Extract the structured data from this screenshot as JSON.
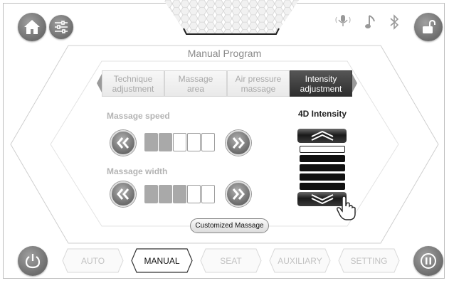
{
  "title": "Manual Program",
  "tabs": [
    {
      "label": "Technique\nadjustment",
      "active": false
    },
    {
      "label": "Massage\narea",
      "active": false
    },
    {
      "label": "Air pressure\nmassage",
      "active": false
    },
    {
      "label": "Intensity\nadjustment",
      "active": true
    }
  ],
  "speed": {
    "label": "Massage speed",
    "level": 2,
    "max": 5
  },
  "width": {
    "label": "Massage width",
    "level": 3,
    "max": 5
  },
  "intensity": {
    "label": "4D Intensity",
    "level": 4,
    "max": 5
  },
  "custom_button": "Customized Massage",
  "bottom_tabs": [
    {
      "label": "AUTO",
      "active": false
    },
    {
      "label": "MANUAL",
      "active": true
    },
    {
      "label": "SEAT",
      "active": false
    },
    {
      "label": "AUXILIARY",
      "active": false
    },
    {
      "label": "SETTING",
      "active": false
    }
  ],
  "icons": [
    "home-icon",
    "settings-sliders-icon",
    "microphone-icon",
    "music-note-icon",
    "bluetooth-icon",
    "unlock-icon",
    "power-icon",
    "pause-icon"
  ],
  "colors": {
    "active_tab": "#3a3a3a",
    "segment_on": "#a9a9a9",
    "button_gray": "#7a7a7a"
  }
}
